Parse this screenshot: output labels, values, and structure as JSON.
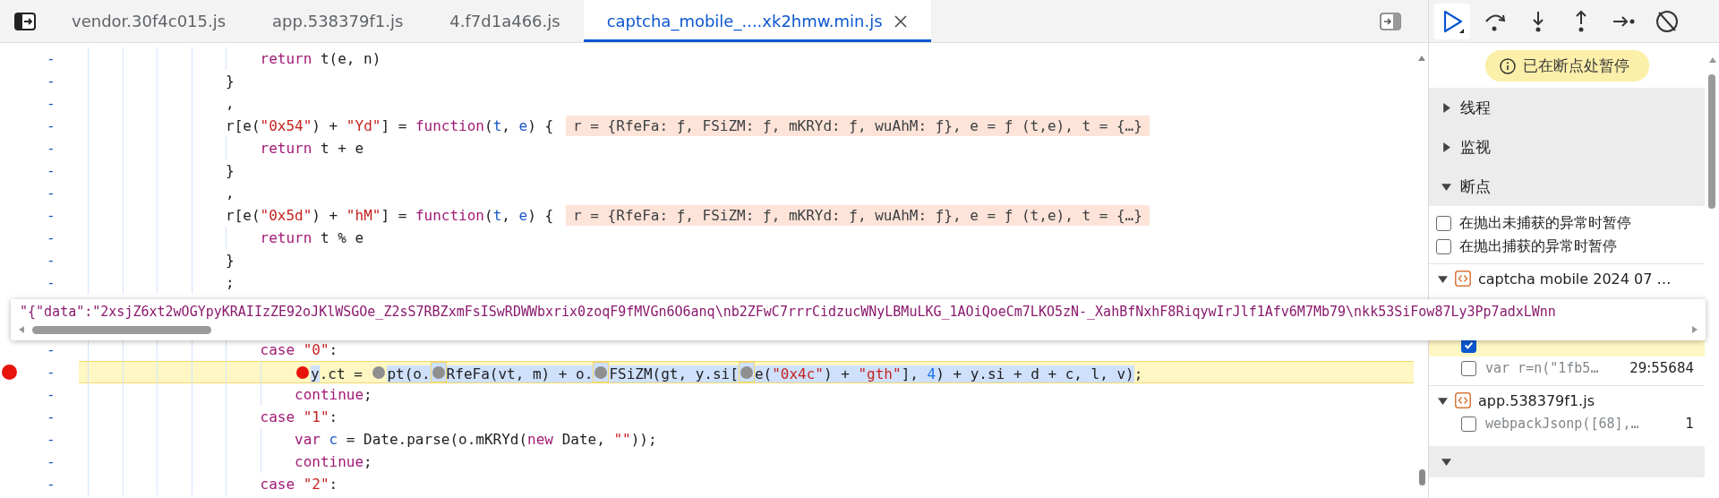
{
  "tabs": [
    {
      "label": "vendor.30f4c015.js",
      "selected": false
    },
    {
      "label": "app.538379f1.js",
      "selected": false
    },
    {
      "label": "4.f7d1a466.js",
      "selected": false
    },
    {
      "label": "captcha_mobile_....xk2hmw.min.js",
      "selected": true
    }
  ],
  "code": {
    "lines": [
      {
        "children": [
          {
            "number": "-",
            "breakpoint": false,
            "execution": false,
            "tokens": [
              {
                "kind": "keyword",
                "text": "return"
              },
              {
                "kind": "plain",
                "text": " t(e, n)"
              }
            ]
          }
        ]
      },
      {
        "number": "-",
        "breakpoint": false,
        "execution": false,
        "tokens": [
          {
            "kind": "plain",
            "text": "}"
          }
        ]
      },
      {
        "number": "-",
        "breakpoint": false,
        "execution": false,
        "tokens": [
          {
            "kind": "plain",
            "text": ","
          }
        ]
      },
      {
        "number": "-",
        "breakpoint": false,
        "execution": false,
        "tokens": [
          {
            "kind": "plain",
            "text": "r[e("
          },
          {
            "kind": "string",
            "text": "\"0x54\""
          },
          {
            "kind": "plain",
            "text": ") + "
          },
          {
            "kind": "string",
            "text": "\"Yd\""
          },
          {
            "kind": "plain",
            "text": "] = "
          },
          {
            "kind": "keyword",
            "text": "function"
          },
          {
            "kind": "plain",
            "text": "("
          },
          {
            "kind": "param",
            "text": "t"
          },
          {
            "kind": "plain",
            "text": ", "
          },
          {
            "kind": "param",
            "text": "e"
          },
          {
            "kind": "plain",
            "text": ") {"
          }
        ],
        "value": "r = {RfeFa: ƒ, FSiZM: ƒ, mKRYd: ƒ, wuAhM: ƒ}, e = ƒ (t,e), t = {…}",
        "children": [
          {
            "number": "-",
            "breakpoint": false,
            "execution": false,
            "tokens": [
              {
                "kind": "keyword",
                "text": "return"
              },
              {
                "kind": "plain",
                "text": " t + e"
              }
            ]
          }
        ]
      },
      {
        "number": "-",
        "breakpoint": false,
        "execution": false,
        "tokens": [
          {
            "kind": "plain",
            "text": "}"
          }
        ]
      },
      {
        "number": "-",
        "breakpoint": false,
        "execution": false,
        "tokens": [
          {
            "kind": "plain",
            "text": ","
          }
        ]
      },
      {
        "number": "-",
        "breakpoint": false,
        "execution": false,
        "tokens": [
          {
            "kind": "plain",
            "text": "r[e("
          },
          {
            "kind": "string",
            "text": "\"0x5d\""
          },
          {
            "kind": "plain",
            "text": ") + "
          },
          {
            "kind": "string",
            "text": "\"hM\""
          },
          {
            "kind": "plain",
            "text": "] = "
          },
          {
            "kind": "keyword",
            "text": "function"
          },
          {
            "kind": "plain",
            "text": "("
          },
          {
            "kind": "param",
            "text": "t"
          },
          {
            "kind": "plain",
            "text": ", "
          },
          {
            "kind": "param",
            "text": "e"
          },
          {
            "kind": "plain",
            "text": ") {"
          }
        ],
        "value": "r = {RfeFa: ƒ, FSiZM: ƒ, mKRYd: ƒ, wuAhM: ƒ}, e = ƒ (t,e), t = {…}",
        "children": [
          {
            "number": "-",
            "breakpoint": false,
            "execution": false,
            "tokens": [
              {
                "kind": "keyword",
                "text": "return"
              },
              {
                "kind": "plain",
                "text": " t % e"
              }
            ]
          }
        ]
      },
      {
        "number": "-",
        "breakpoint": false,
        "execution": false,
        "tokens": [
          {
            "kind": "plain",
            "text": "}"
          }
        ]
      },
      {
        "number": "-",
        "breakpoint": false,
        "execution": false,
        "tokens": [
          {
            "kind": "plain",
            "text": ";"
          }
        ]
      },
      {
        "children": [
          {
            "number": "-",
            "breakpoint": false,
            "execution": false,
            "tokens": [
              {
                "kind": "keyword",
                "text": "case"
              },
              {
                "kind": "string",
                "text": " \"0\""
              },
              {
                "kind": "plain",
                "text": ":"
              }
            ],
            "children": [
              {
                "number": "-",
                "breakpoint": true,
                "execution": true,
                "tokens": [
                  {
                    "kind": "marker",
                    "active": true,
                    "selected": false
                  },
                  {
                    "kind": "plain",
                    "text": "y",
                    "selected": true
                  },
                  {
                    "kind": "plain",
                    "text": ".ct = ",
                    "selected": false
                  },
                  {
                    "kind": "marker",
                    "active": false,
                    "selected": false
                  },
                  {
                    "kind": "plain",
                    "text": "pt(o.",
                    "selected": true
                  },
                  {
                    "kind": "marker",
                    "active": false,
                    "selected": true
                  },
                  {
                    "kind": "plain",
                    "text": "RfeFa(vt, m) + o.",
                    "selected": true
                  },
                  {
                    "kind": "marker",
                    "active": false,
                    "selected": true
                  },
                  {
                    "kind": "plain",
                    "text": "FSiZM(gt, y.si[",
                    "selected": true
                  },
                  {
                    "kind": "marker",
                    "active": false,
                    "selected": true
                  },
                  {
                    "kind": "plain",
                    "text": "e(",
                    "selected": true
                  },
                  {
                    "kind": "string",
                    "text": "\"0x4c\"",
                    "selected": true
                  },
                  {
                    "kind": "plain",
                    "text": ") + ",
                    "selected": true
                  },
                  {
                    "kind": "string",
                    "text": "\"gth\"",
                    "selected": true
                  },
                  {
                    "kind": "plain",
                    "text": "], ",
                    "selected": true
                  },
                  {
                    "kind": "number",
                    "text": "4",
                    "selected": true
                  },
                  {
                    "kind": "plain",
                    "text": ") + y.si + d + c, l, v)",
                    "selected": true
                  },
                  {
                    "kind": "plain",
                    "text": ";",
                    "selected": false
                  }
                ]
              },
              {
                "number": "-",
                "breakpoint": false,
                "execution": false,
                "tokens": [
                  {
                    "kind": "keyword",
                    "text": "continue"
                  },
                  {
                    "kind": "plain",
                    "text": ";"
                  }
                ]
              }
            ]
          },
          {
            "number": "-",
            "breakpoint": false,
            "execution": false,
            "tokens": [
              {
                "kind": "keyword",
                "text": "case"
              },
              {
                "kind": "string",
                "text": " \"1\""
              },
              {
                "kind": "plain",
                "text": ":"
              }
            ],
            "children": [
              {
                "number": "-",
                "breakpoint": false,
                "execution": false,
                "tokens": [
                  {
                    "kind": "keyword",
                    "text": "var"
                  },
                  {
                    "kind": "param",
                    "text": " c"
                  },
                  {
                    "kind": "plain",
                    "text": " = Date.parse(o.mKRYd("
                  },
                  {
                    "kind": "keyword",
                    "text": "new"
                  },
                  {
                    "kind": "plain",
                    "text": " Date, "
                  },
                  {
                    "kind": "string",
                    "text": "\"\""
                  },
                  {
                    "kind": "plain",
                    "text": "));"
                  }
                ]
              },
              {
                "number": "-",
                "breakpoint": false,
                "execution": false,
                "tokens": [
                  {
                    "kind": "keyword",
                    "text": "continue"
                  },
                  {
                    "kind": "plain",
                    "text": ";"
                  }
                ]
              }
            ]
          },
          {
            "number": "-",
            "breakpoint": false,
            "execution": false,
            "tokens": [
              {
                "kind": "keyword",
                "text": "case"
              },
              {
                "kind": "string",
                "text": " \"2\""
              },
              {
                "kind": "plain",
                "text": ":"
              }
            ]
          }
        ]
      }
    ]
  },
  "tooltip": {
    "text": "\"{\"data\":\"2xsjZ6xt2wOGYpyKRAIIzZE92oJKlWSGOe_Z2sS7RBZxmFsISwRDWWbxrix0zoqF9fMVGn6O6anq\\nb2ZFwC7rrrCidzucWNyLBMuLKG_1AOiQoeCm7LKO5zN-_XahBfNxhF8RiqywIrJlf1Afv6M7Mb79\\nkk53SiFow87Ly3Pp7adxLWnn"
  },
  "debugger": {
    "status": "已在断点处暂停",
    "sections": [
      {
        "label": "线程",
        "expanded": false
      },
      {
        "label": "监视",
        "expanded": false
      },
      {
        "label": "断点",
        "expanded": true
      }
    ],
    "pause_options": [
      {
        "label": "在抛出未捕获的异常时暂停",
        "checked": false
      },
      {
        "label": "在抛出捕获的异常时暂停",
        "checked": false
      }
    ],
    "breakpoint_files": [
      {
        "name": "captcha mobile 2024 07 …",
        "expanded": true,
        "breakpoints": [
          {
            "checked": true,
            "current": true
          },
          {
            "code": "var r=n(\"1fb5…",
            "location": "29:55684",
            "checked": false,
            "current": false
          }
        ]
      },
      {
        "name": "app.538379f1.js",
        "expanded": true,
        "breakpoints": [
          {
            "code": "webpackJsonp([68],…",
            "location": "1",
            "checked": false,
            "current": false
          }
        ]
      }
    ],
    "footer_section": {
      "expanded": true
    }
  }
}
